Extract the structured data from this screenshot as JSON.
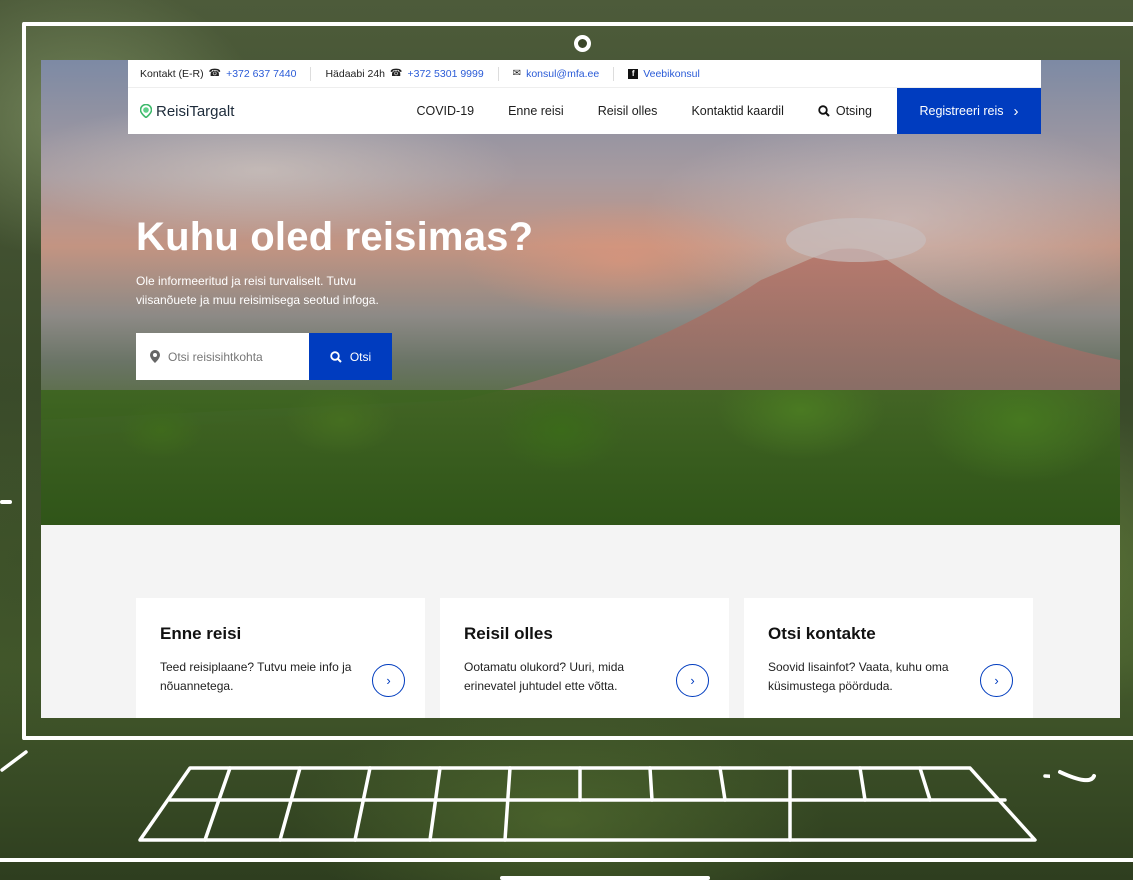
{
  "topbar": {
    "contact_label": "Kontakt (E-R)",
    "contact_phone": "+372 637 7440",
    "emergency_label": "Hädaabi 24h",
    "emergency_phone": "+372 5301 9999",
    "email": "konsul@mfa.ee",
    "facebook": "Veebikonsul"
  },
  "nav": {
    "logo": "ReisiTargalt",
    "items": [
      "COVID-19",
      "Enne reisi",
      "Reisil olles",
      "Kontaktid kaardil"
    ],
    "search_label": "Otsing",
    "cta_label": "Registreeri reis"
  },
  "hero": {
    "title": "Kuhu oled reisimas?",
    "subtitle": "Ole informeeritud ja reisi turvaliselt. Tutvu viisanõuete ja muu reisimisega seotud infoga.",
    "search_placeholder": "Otsi reisisihtkohta",
    "search_button": "Otsi"
  },
  "cards": [
    {
      "title": "Enne reisi",
      "text": "Teed reisiplaane? Tutvu meie info ja nõuannetega."
    },
    {
      "title": "Reisil olles",
      "text": "Ootamatu olukord? Uuri, mida erinevatel juhtudel ette võtta."
    },
    {
      "title": "Otsi kontakte",
      "text": "Soovid lisainfot? Vaata, kuhu oma küsimustega pöörduda."
    }
  ],
  "colors": {
    "accent": "#003cbf",
    "link": "#2a5bd7"
  }
}
